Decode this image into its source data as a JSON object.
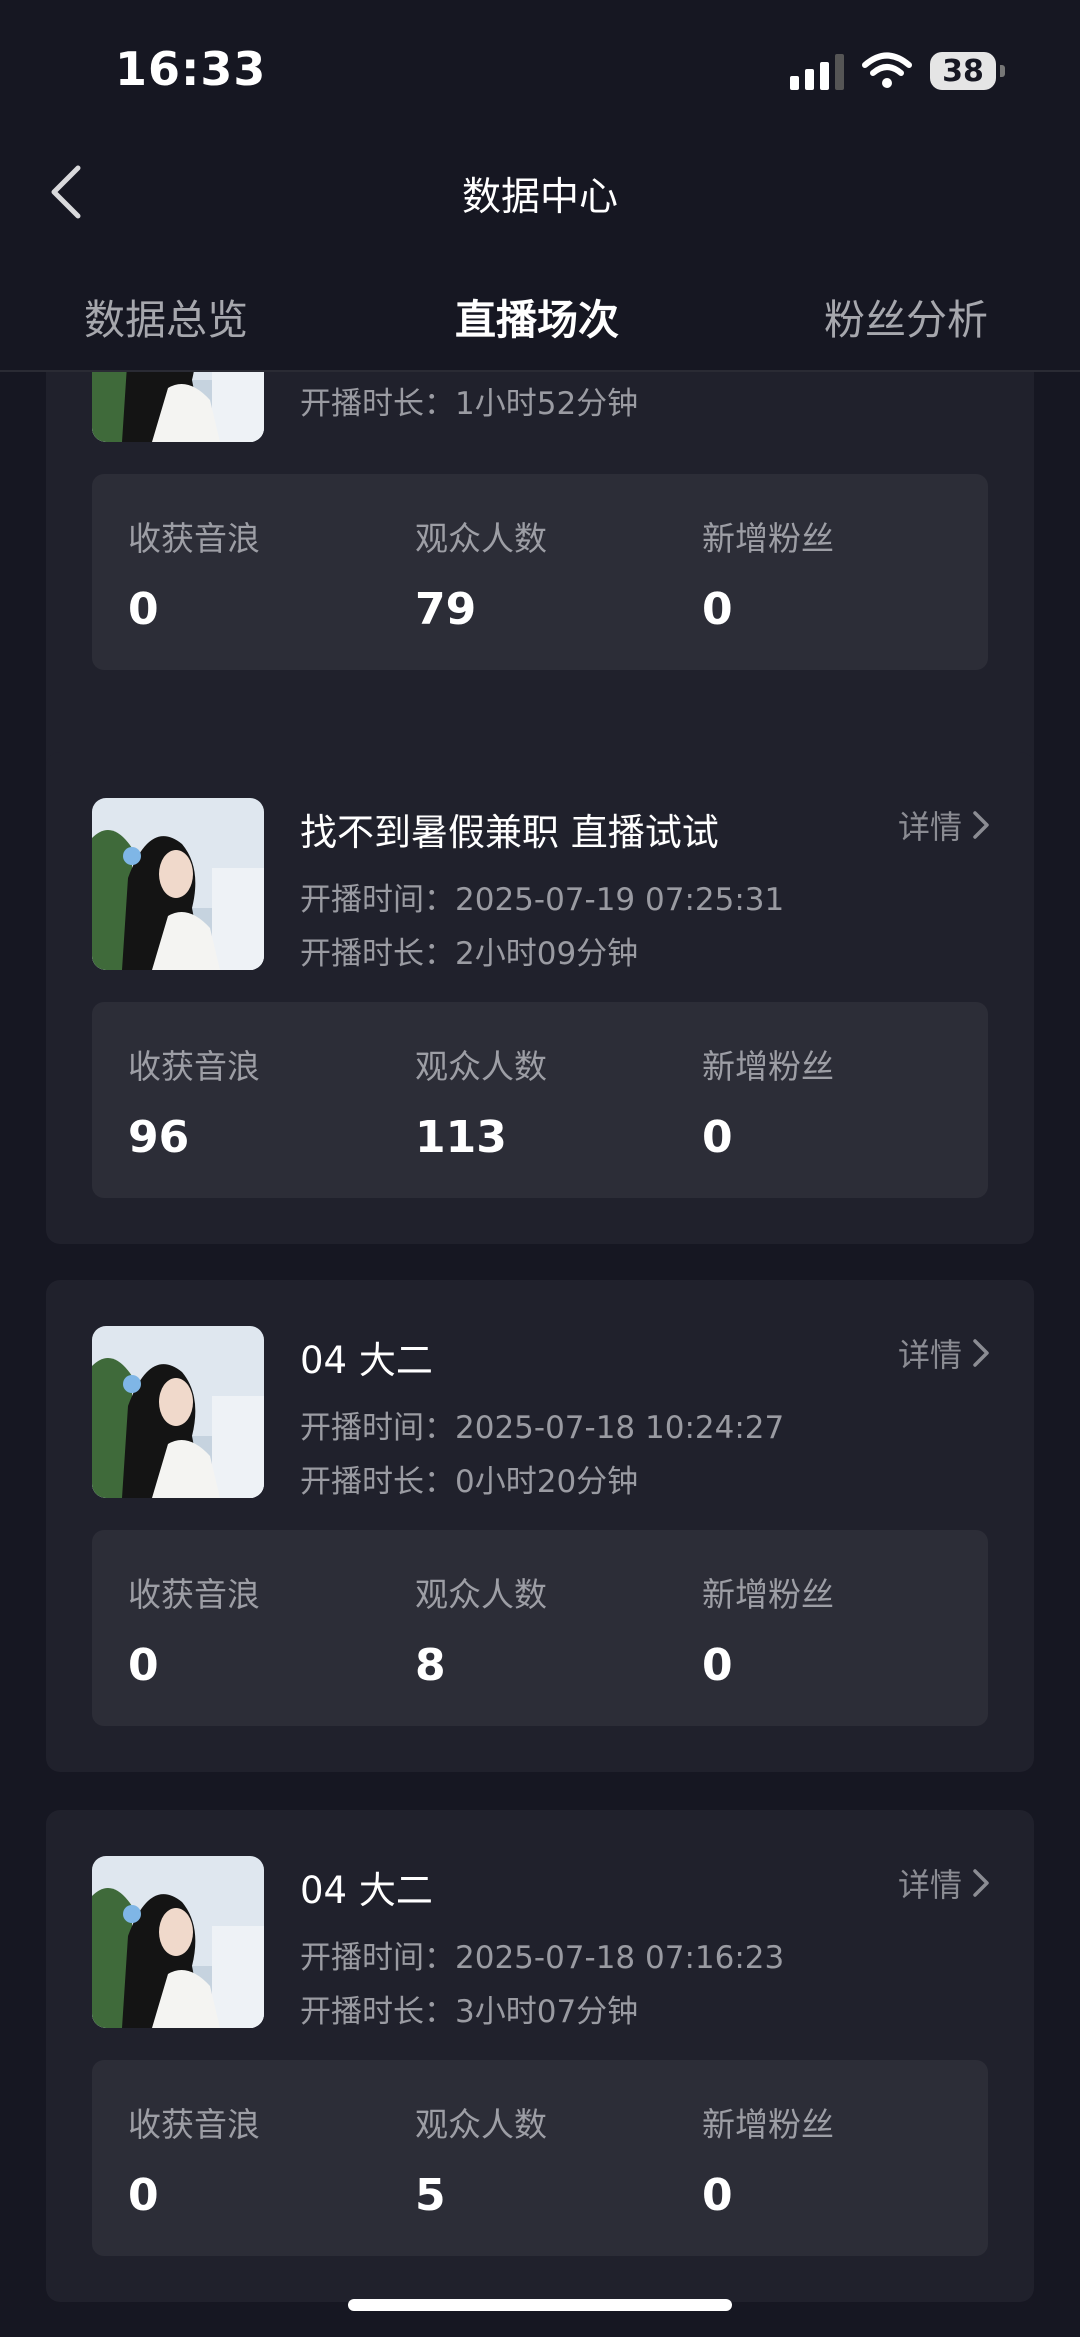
{
  "status_bar": {
    "time": "16:33",
    "battery": "38"
  },
  "nav": {
    "title": "数据中心"
  },
  "tabs": [
    {
      "label": "数据总览",
      "active": false
    },
    {
      "label": "直播场次",
      "active": true
    },
    {
      "label": "粉丝分析",
      "active": false
    }
  ],
  "card0": {
    "duration": "开播时长：1小时52分钟",
    "stats": [
      {
        "label": "收获音浪",
        "value": "0"
      },
      {
        "label": "观众人数",
        "value": "79"
      },
      {
        "label": "新增粉丝",
        "value": "0"
      }
    ]
  },
  "cards": [
    {
      "title": "找不到暑假兼职 直播试试",
      "detail": "详情",
      "start": "开播时间：2025-07-19 07:25:31",
      "duration": "开播时长：2小时09分钟",
      "stats": [
        {
          "label": "收获音浪",
          "value": "96"
        },
        {
          "label": "观众人数",
          "value": "113"
        },
        {
          "label": "新增粉丝",
          "value": "0"
        }
      ]
    },
    {
      "title": "04 大二",
      "detail": "详情",
      "start": "开播时间：2025-07-18 10:24:27",
      "duration": "开播时长：0小时20分钟",
      "stats": [
        {
          "label": "收获音浪",
          "value": "0"
        },
        {
          "label": "观众人数",
          "value": "8"
        },
        {
          "label": "新增粉丝",
          "value": "0"
        }
      ]
    },
    {
      "title": "04 大二",
      "detail": "详情",
      "start": "开播时间：2025-07-18 07:16:23",
      "duration": "开播时长：3小时07分钟",
      "stats": [
        {
          "label": "收获音浪",
          "value": "0"
        },
        {
          "label": "观众人数",
          "value": "5"
        },
        {
          "label": "新增粉丝",
          "value": "0"
        }
      ]
    }
  ],
  "colors": {
    "background": "#161722",
    "card": "#20212c",
    "stats_panel": "#2c2d37",
    "highlight": "#f2c531"
  }
}
